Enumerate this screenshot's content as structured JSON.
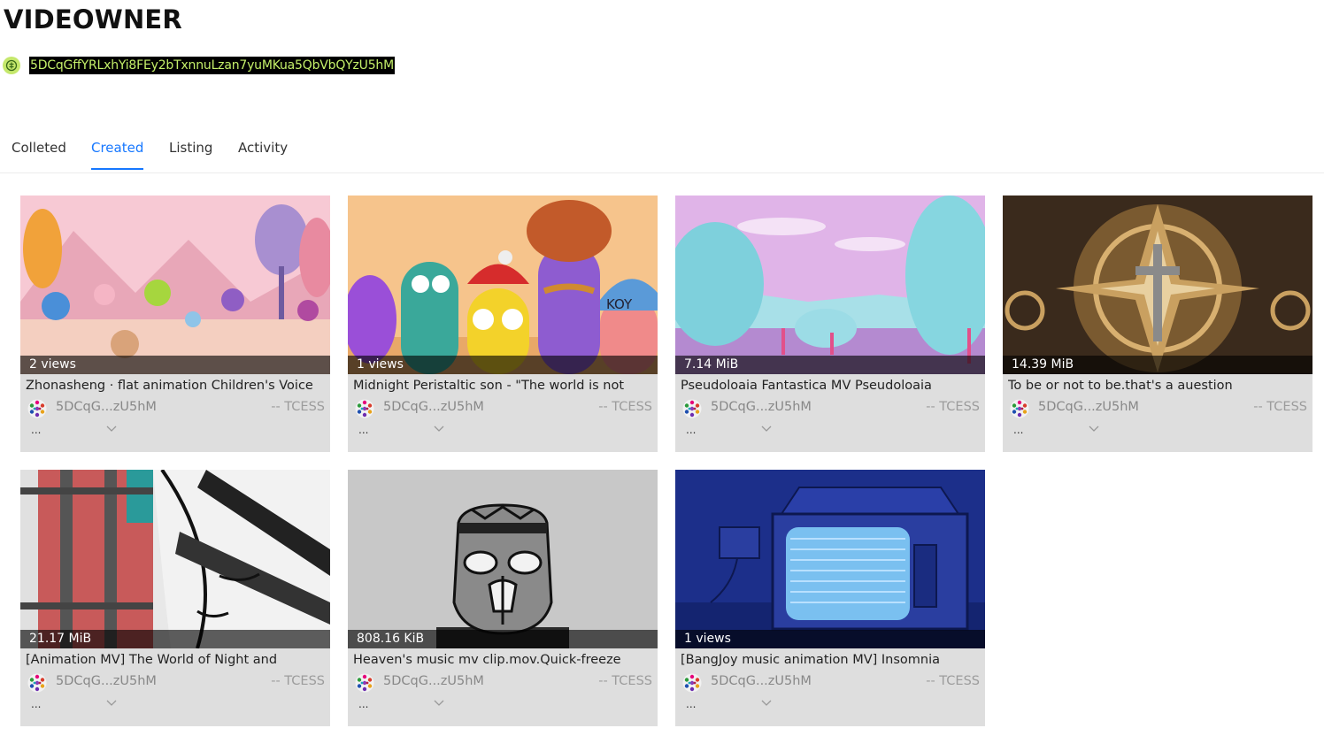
{
  "header": {
    "title": "VIDEOWNER",
    "address": "5DCqGffYRLxhYi8FEy2bTxnnuLzan7yuMKua5QbVbQYzU5hM"
  },
  "tabs": [
    {
      "label": "Colleted",
      "active": false
    },
    {
      "label": "Created",
      "active": true
    },
    {
      "label": "Listing",
      "active": false
    },
    {
      "label": "Activity",
      "active": false
    }
  ],
  "cards": [
    {
      "overlay": "2 views",
      "title": "Zhonasheng · flat animation Children's Voice",
      "owner": "5DCqG...zU5hM",
      "tag": "-- TCESS",
      "more": "..."
    },
    {
      "overlay": "1 views",
      "title": "Midnight Peristaltic son - \"The world is not",
      "owner": "5DCqG...zU5hM",
      "tag": "-- TCESS",
      "more": "..."
    },
    {
      "overlay": "7.14 MiB",
      "title": "Pseudoloaia Fantastica MV Pseudoloaia",
      "owner": "5DCqG...zU5hM",
      "tag": "-- TCESS",
      "more": "..."
    },
    {
      "overlay": "14.39 MiB",
      "title": "To be or not to be.that's a auestion",
      "owner": "5DCqG...zU5hM",
      "tag": "-- TCESS",
      "more": "..."
    },
    {
      "overlay": "21.17 MiB",
      "title": "[Animation MV] The World of Night and",
      "owner": "5DCqG...zU5hM",
      "tag": "-- TCESS",
      "more": "..."
    },
    {
      "overlay": "808.16 KiB",
      "title": "Heaven's music mv clip.mov.Quick-freeze",
      "owner": "5DCqG...zU5hM",
      "tag": "-- TCESS",
      "more": "..."
    },
    {
      "overlay": "1 views",
      "title": "[BangJoy music animation MV] Insomnia",
      "owner": "5DCqG...zU5hM",
      "tag": "-- TCESS",
      "more": "..."
    }
  ],
  "icons": {
    "address": "wallet-icon",
    "avatar": "polkadot-avatar-icon",
    "expand": "chevron-down-icon"
  },
  "colors": {
    "accent": "#1677ff",
    "address_bg": "#000000",
    "address_text": "#c5f06a",
    "card_bg": "#dedede"
  }
}
